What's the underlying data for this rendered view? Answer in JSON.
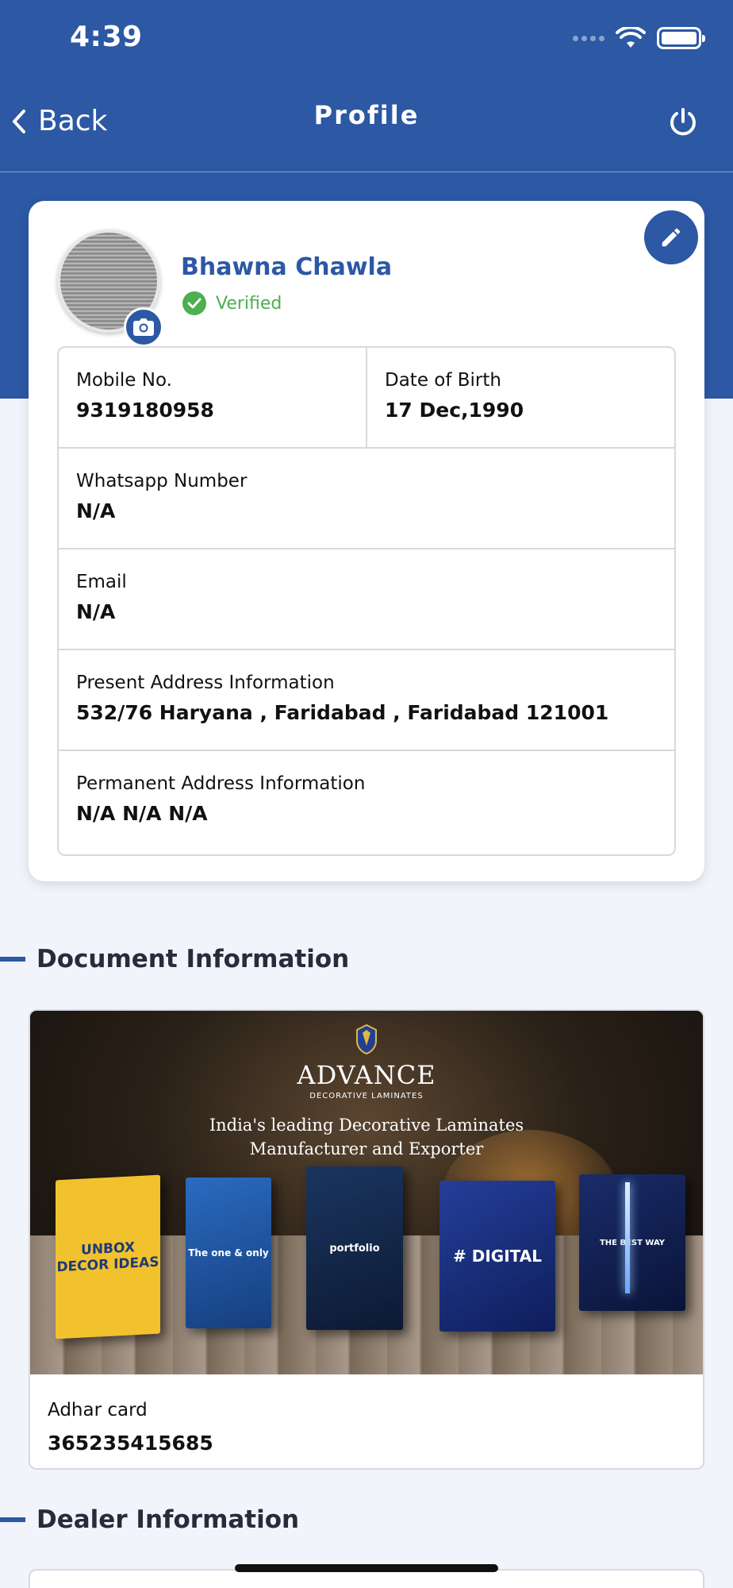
{
  "status_bar": {
    "time": "4:39"
  },
  "nav": {
    "back_label": "Back",
    "title": "Profile"
  },
  "profile": {
    "name": "Bhawna Chawla",
    "status": "Verified",
    "fields": [
      {
        "label": "Mobile No.",
        "value": "9319180958"
      },
      {
        "label": "Date of Birth",
        "value": "17 Dec,1990"
      },
      {
        "label": "Whatsapp Number",
        "value": "N/A"
      },
      {
        "label": "Email",
        "value": "N/A"
      },
      {
        "label": "Present Address Information",
        "value": "532/76 Haryana , Faridabad , Faridabad 121001"
      },
      {
        "label": "Permanent Address Information",
        "value": "N/A N/A N/A"
      }
    ]
  },
  "documents": {
    "section_title": "Document Information",
    "image": {
      "brand": "ADVANCE",
      "brand_sub": "DECORATIVE LAMINATES",
      "tagline_1": "India's leading Decorative Laminates",
      "tagline_2": "Manufacturer and Exporter",
      "books": [
        "UNBOX DECOR IDEAS",
        "The one & only",
        "portfolio",
        "# DIGITAL",
        "THE BEST WAY"
      ]
    },
    "label": "Adhar card",
    "value": "365235415685"
  },
  "dealer": {
    "section_title": "Dealer Information"
  },
  "colors": {
    "primary": "#2c58a4",
    "verified": "#4caf50",
    "background": "#f2f4fb"
  },
  "icons": [
    "back-chevron-icon",
    "power-icon",
    "edit-pencil-icon",
    "camera-icon",
    "check-circle-icon",
    "wifi-icon",
    "battery-icon"
  ]
}
